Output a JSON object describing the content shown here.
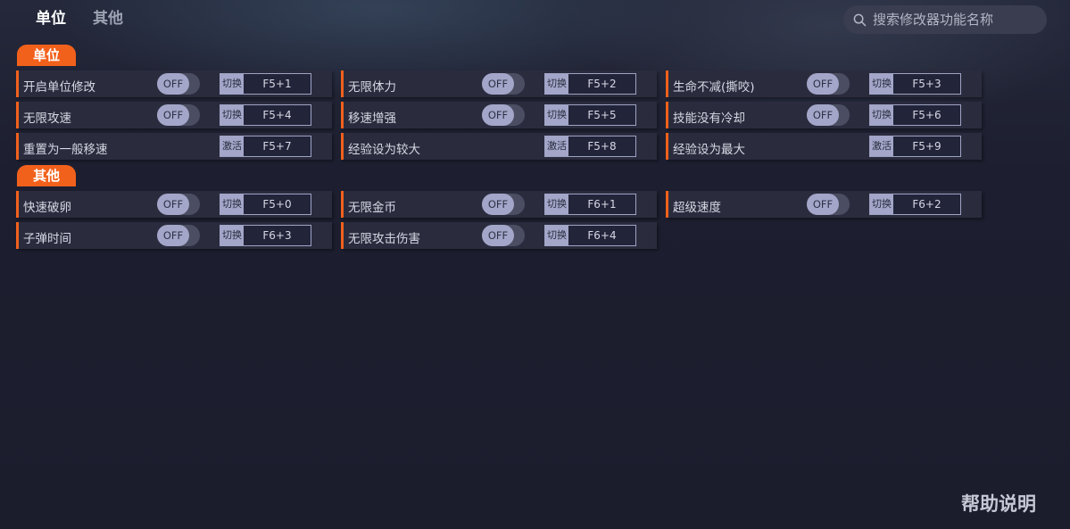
{
  "tabs": [
    {
      "label": "单位",
      "active": true
    },
    {
      "label": "其他",
      "active": false
    }
  ],
  "search": {
    "placeholder": "搜索修改器功能名称",
    "value": ""
  },
  "sections": {
    "units": {
      "title": "单位",
      "items": [
        {
          "name": "开启单位修改",
          "toggle": "OFF",
          "action": "切换",
          "key": "F5+1"
        },
        {
          "name": "无限体力",
          "toggle": "OFF",
          "action": "切换",
          "key": "F5+2"
        },
        {
          "name": "生命不减(撕咬)",
          "toggle": "OFF",
          "action": "切换",
          "key": "F5+3"
        },
        {
          "name": "无限攻速",
          "toggle": "OFF",
          "action": "切换",
          "key": "F5+4"
        },
        {
          "name": "移速增强",
          "toggle": "OFF",
          "action": "切换",
          "key": "F5+5"
        },
        {
          "name": "技能没有冷却",
          "toggle": "OFF",
          "action": "切换",
          "key": "F5+6"
        },
        {
          "name": "重置为一般移速",
          "toggle": null,
          "action": "激活",
          "key": "F5+7"
        },
        {
          "name": "经验设为较大",
          "toggle": null,
          "action": "激活",
          "key": "F5+8"
        },
        {
          "name": "经验设为最大",
          "toggle": null,
          "action": "激活",
          "key": "F5+9"
        }
      ]
    },
    "other": {
      "title": "其他",
      "items": [
        {
          "name": "快速破卵",
          "toggle": "OFF",
          "action": "切换",
          "key": "F5+0"
        },
        {
          "name": "无限金币",
          "toggle": "OFF",
          "action": "切换",
          "key": "F6+1"
        },
        {
          "name": "超级速度",
          "toggle": "OFF",
          "action": "切换",
          "key": "F6+2"
        },
        {
          "name": "子弹时间",
          "toggle": "OFF",
          "action": "切换",
          "key": "F6+3"
        },
        {
          "name": "无限攻击伤害",
          "toggle": "OFF",
          "action": "切换",
          "key": "F6+4"
        }
      ]
    }
  },
  "help": {
    "label": "帮助说明"
  },
  "colors": {
    "accent": "#f2611c",
    "background": "#1c1d2d",
    "card": "#2a2c3e",
    "toggle_knob": "#a3a6c8"
  }
}
